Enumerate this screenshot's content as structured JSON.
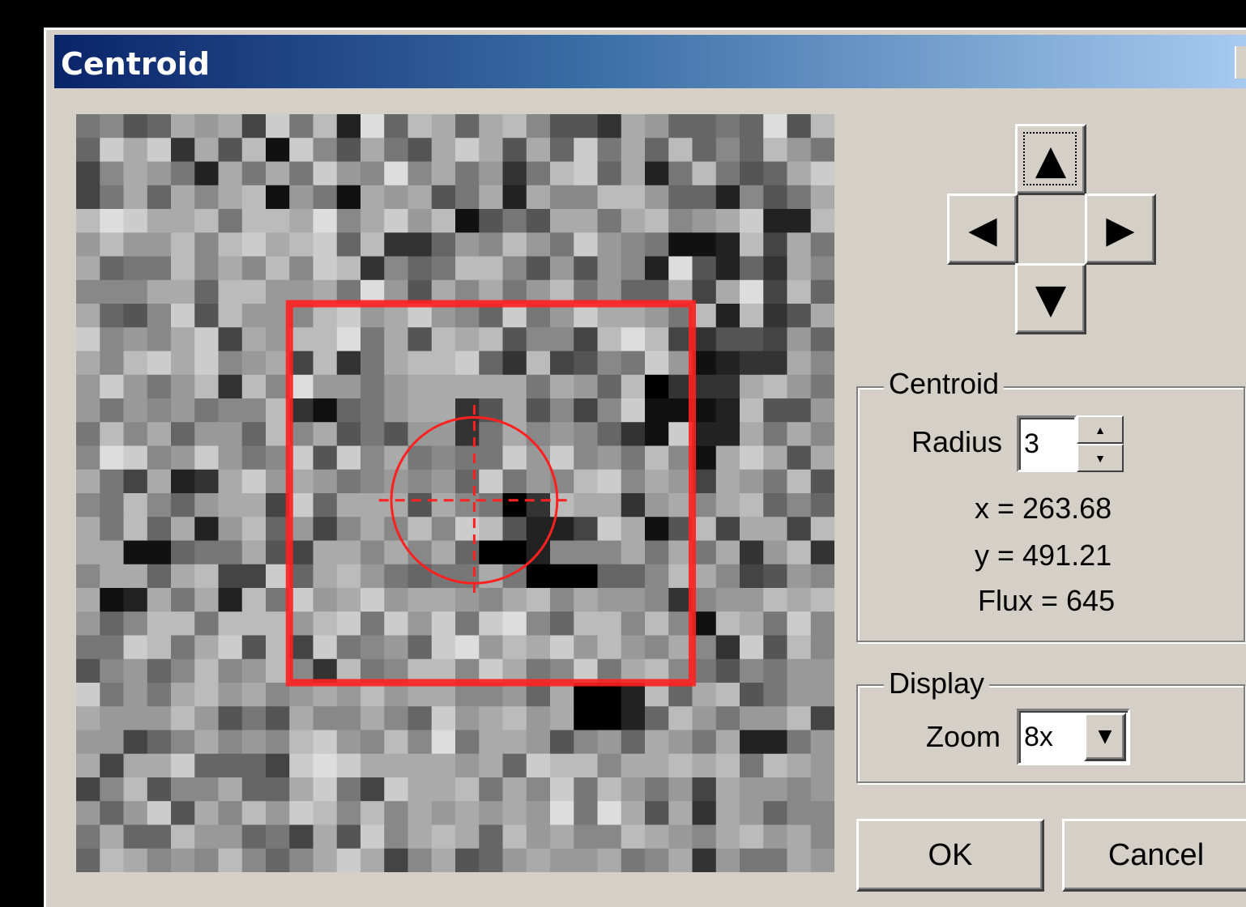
{
  "window": {
    "title": "Centroid"
  },
  "image": {
    "cols": 32,
    "rows": 32,
    "pixels": [
      "7856A9A4C7B2D6BA6AB8553A96676D5B",
      "6CAC3A5B1C85A75ACA5A6C7A6B686B97",
      "48A972A7A7C98D8A7937BC6A27B756AC",
      "47A6A8AB1971A9A57A2A88BB9662857A",
      "BDCAAB7BBAD8AC9B1575AA7AB89AC22B",
      "9B99B8BCABC6B33698B97C987112B4A7",
      "A677B8A8B8CB3867BB8595982D5263A8",
      "888AA6BB99A7D95A8A79B7966A4AD4B6",
      "A658C5B998BC9AC986C79CAA97B2B35A",
      "C898AC4A9BBD7A5BAB5884BDB4355496",
      "A8BCAC89A4B37ABBC63B4587C91233A8",
      "9C979B3B8D9979AAAAA7A96B0333AB97",
      "97989788B31679AA35A5848C1112B559",
      "7B8A6996B8A5759937A898631C22A7A8",
      "8DC89C978C5C8A7877C9C897B81ACA5A",
      "A74A23AC9A9789896C798BC8A94A97B5",
      "87B869AA4C6AAA5A8703BAA39A8AB686",
      "A7B6A29B6948A8B8CB5224CA15B4AA4B",
      "AA11677A54AA8A8A6002888A7A7A39B3",
      "8AA6AB44C6AB97677A7000668BA84598",
      "A12A7A2B7C9AC9AA98AB8A9983899BAB",
      "968BB7BBB9BC7C9C7CD86BB8B81BA7C8",
      "77CB7AC5B4C7896CD9BAC9B98A83C5B8",
      "58968B89B83B78BB8CA78C7AB8758799",
      "C797AB9A89A9B9AA8896A002B6AB5799",
      "A999B9575A88A86C9AB9A0026B9799B4",
      "99468A898BC98B8D7AA95896A97A2279",
      "A4AAC6664CDCAAAA9A6CBB8AABAB7BA9",
      "48B588A66AC74CAAB7A8C7B9794A9989",
      "969C5A8B9CB8B8A9A9A9D7DA5A3A9688",
      "7A66B99674A5C8ABA6B9A88BA98AB9A8",
      "6BA898B868ACA48A569A99A78A3977A9"
    ],
    "selection_box": {
      "col": 9,
      "row": 8,
      "cols": 17,
      "rows": 16
    },
    "centroid_marker": {
      "col": 16.8,
      "row": 16.3,
      "radius": 3.5
    },
    "overlay_color": "#ff2020"
  },
  "nudge": {
    "up_icon": "up-triangle-icon",
    "left_icon": "left-triangle-icon",
    "right_icon": "right-triangle-icon",
    "down_icon": "down-triangle-icon"
  },
  "centroid_group": {
    "legend": "Centroid",
    "radius_label": "Radius",
    "radius_value": "3",
    "x_text": "x = 263.68",
    "y_text": "y = 491.21",
    "flux_text": "Flux = 645"
  },
  "display_group": {
    "legend": "Display",
    "zoom_label": "Zoom",
    "zoom_value": "8x"
  },
  "buttons": {
    "ok": "OK",
    "cancel": "Cancel"
  }
}
